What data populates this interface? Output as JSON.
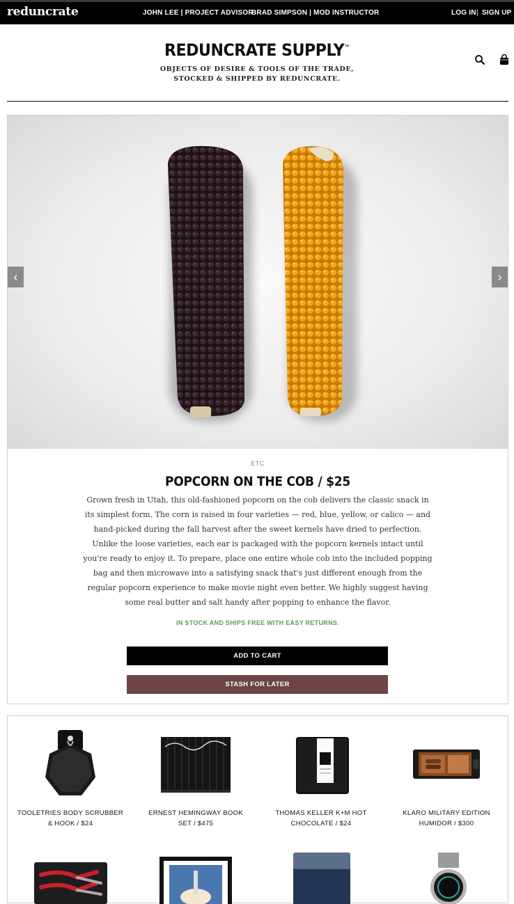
{
  "topbar": {
    "logo": "reduncrate",
    "links": {
      "advisor": "JOHN LEE | PROJECT ADVISOR",
      "instructor": "BRAD SIMPSON | MOD INSTRUCTOR",
      "login": "LOG IN",
      "separator": "|",
      "signup": "SIGN UP"
    }
  },
  "header": {
    "brand": "REDUNCRATE SUPPLY",
    "trademark": "™",
    "tagline_line1": "OBJECTS OF DESIRE & TOOLS OF THE TRADE,",
    "tagline_line2": "STOCKED & SHIPPED BY REDUNCRATE.",
    "icons": [
      "search-icon",
      "cart-icon"
    ]
  },
  "product": {
    "category": "ETC",
    "title": "POPCORN ON THE COB / $25",
    "description": "Grown fresh in Utah, this old-fashioned popcorn on the cob delivers the classic snack in its simplest form. The corn is raised in four varieties — red, blue, yellow, or calico — and hand-picked during the fall harvest after the sweet kernels have dried to perfection. Unlike the loose varieties, each ear is packaged with the popcorn kernels intact until you're ready to enjoy it. To prepare, place one entire whole cob into the included popping bag and then microwave into a satisfying snack that's just different enough from the regular popcorn experience to make movie night even better. We highly suggest having some real butter and salt handy after popping to enhance the flavor.",
    "stock_status": "IN STOCK AND SHIPS FREE WITH EASY RETURNS.",
    "add_to_cart": "ADD TO CART",
    "stash": "STASH FOR LATER",
    "carousel": {
      "prev": "‹",
      "next": "›"
    }
  },
  "related": [
    {
      "line1": "TOOLETRIES BODY SCRUBBER",
      "line2": "& HOOK  /  $24"
    },
    {
      "line1": "ERNEST HEMINGWAY BOOK",
      "line2": "SET  /  $475"
    },
    {
      "line1": "THOMAS KELLER K+M HOT",
      "line2": "CHOCOLATE  /  $24"
    },
    {
      "line1": "KLARO MILITARY EDITION",
      "line2": "HUMIDOR  /  $300"
    }
  ],
  "colors": {
    "accent_stash": "#6e4444",
    "stock_green": "#5a9a5a"
  }
}
